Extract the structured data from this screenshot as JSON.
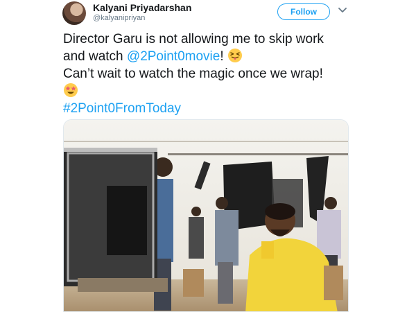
{
  "tweet": {
    "user": {
      "name": "Kalyani Priyadarshan",
      "handle": "@kalyanipriyan"
    },
    "follow_label": "Follow",
    "text": {
      "line1": "Director Garu is not allowing me to skip work",
      "line2_pre": "and  watch ",
      "mention": "@2Point0movie",
      "line2_post": "!",
      "line3": "Can’t wait to watch the magic once we wrap!",
      "hashtag": "#2Point0FromToday"
    },
    "emojis": [
      "squinting-tongue-emoji",
      "star-struck-emoji"
    ]
  },
  "colors": {
    "accent": "#1da1f2",
    "text": "#14171a",
    "muted": "#657786",
    "border": "#e1e8ed"
  }
}
